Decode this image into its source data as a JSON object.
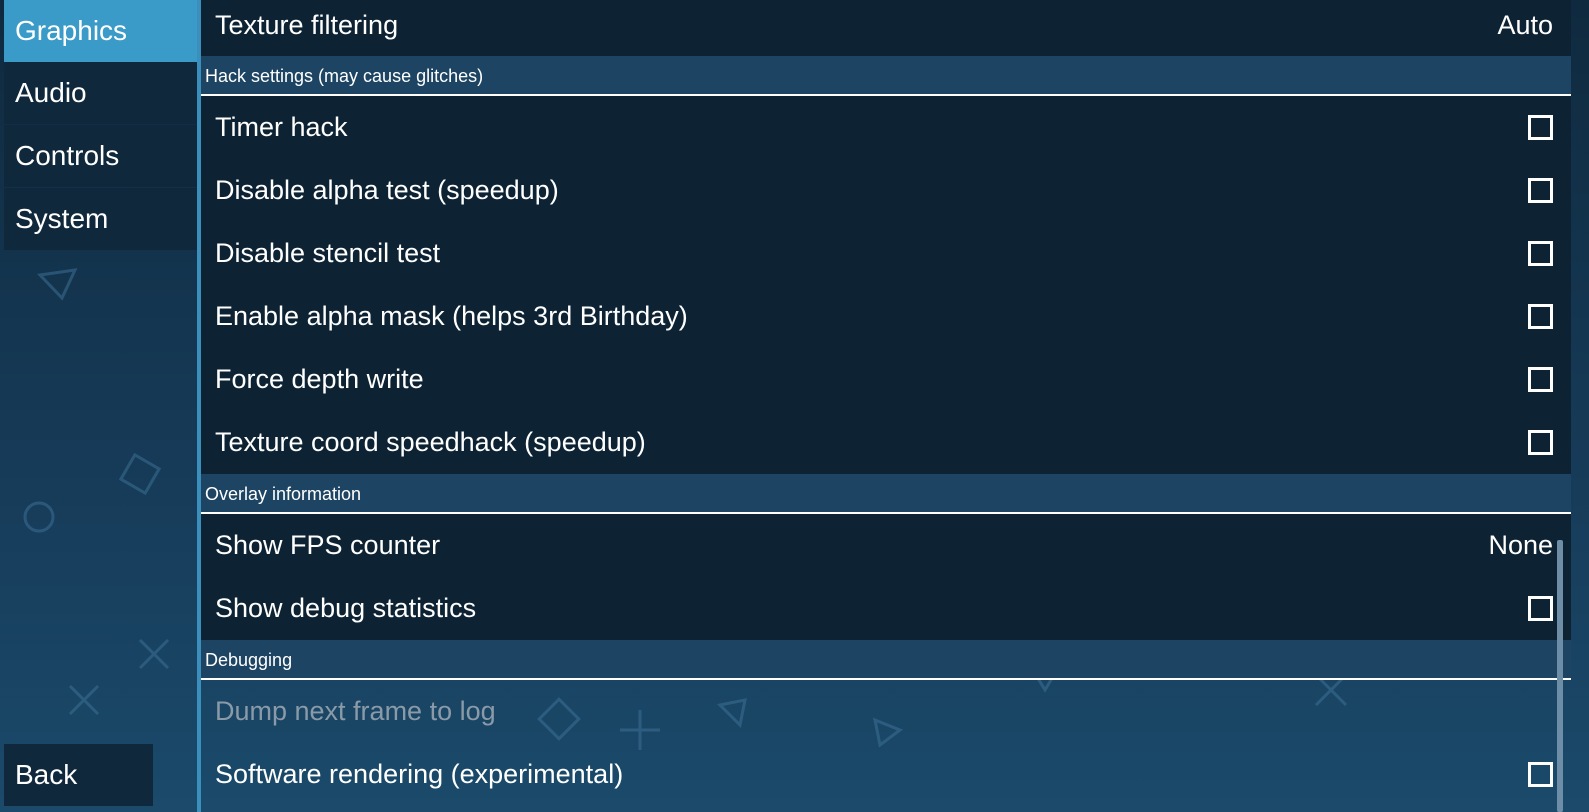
{
  "sidebar": {
    "items": [
      {
        "label": "Graphics",
        "active": true
      },
      {
        "label": "Audio",
        "active": false
      },
      {
        "label": "Controls",
        "active": false
      },
      {
        "label": "System",
        "active": false
      }
    ],
    "back_label": "Back"
  },
  "rows": {
    "texture_filtering": {
      "label": "Texture filtering",
      "value": "Auto"
    },
    "hack_header": "Hack settings (may cause glitches)",
    "timer_hack": {
      "label": "Timer hack",
      "checked": false
    },
    "disable_alpha": {
      "label": "Disable alpha test (speedup)",
      "checked": false
    },
    "disable_stencil": {
      "label": "Disable stencil test",
      "checked": false
    },
    "alpha_mask": {
      "label": "Enable alpha mask (helps 3rd Birthday)",
      "checked": false
    },
    "force_depth": {
      "label": "Force depth write",
      "checked": false
    },
    "texture_coord": {
      "label": "Texture coord speedhack (speedup)",
      "checked": false
    },
    "overlay_header": "Overlay information",
    "show_fps": {
      "label": "Show FPS counter",
      "value": "None"
    },
    "debug_stats": {
      "label": "Show debug statistics",
      "checked": false
    },
    "debugging_header": "Debugging",
    "dump_frame": {
      "label": "Dump next frame to log"
    },
    "software_rendering": {
      "label": "Software rendering (experimental)",
      "checked": false
    }
  },
  "colors": {
    "accent": "#3a9ac8",
    "row_dark": "#0d2334",
    "header_bg": "#1d4563"
  }
}
